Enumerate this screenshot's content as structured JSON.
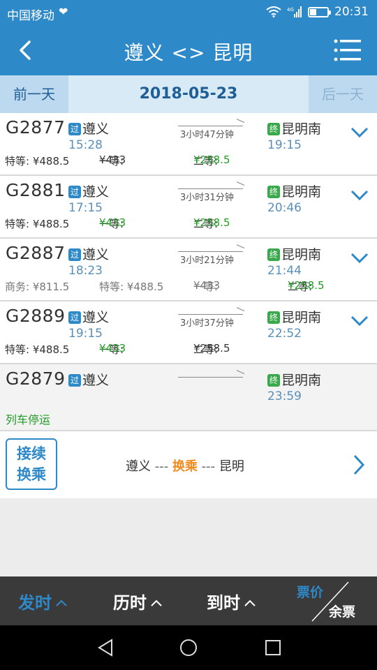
{
  "status": {
    "carrier": "中国移动",
    "network": "4G",
    "time": "20:31"
  },
  "header": {
    "title": "遵义 <> 昆明"
  },
  "datebar": {
    "prev": "前一天",
    "date": "2018-05-23",
    "next": "后一天"
  },
  "badges": {
    "pass": "过",
    "end": "终"
  },
  "trains": [
    {
      "no": "G2877",
      "from": "遵义",
      "dep": "15:28",
      "duration": "3小时47分钟",
      "to": "昆明南",
      "arr": "19:15",
      "p1": "特等: ¥488.5",
      "p2_label": "一等: ",
      "p2_val": "¥433",
      "p3_label": "二等: ",
      "p3_val": "¥258.5"
    },
    {
      "no": "G2881",
      "from": "遵义",
      "dep": "17:15",
      "duration": "3小时31分钟",
      "to": "昆明南",
      "arr": "20:46",
      "p1": "特等: ¥488.5",
      "p2_label": "一等: ",
      "p2_val": "¥433",
      "p3_label": "二等: ",
      "p3_val": "¥258.5"
    },
    {
      "no": "G2887",
      "from": "遵义",
      "dep": "18:23",
      "duration": "3小时21分钟",
      "to": "昆明南",
      "arr": "21:44",
      "p0": "商务: ¥811.5",
      "p1": "特等: ¥488.5",
      "p2_label": "一等: ",
      "p2_val": "¥433",
      "p3_label": "二等: ",
      "p3_val": "¥258.5"
    },
    {
      "no": "G2889",
      "from": "遵义",
      "dep": "19:15",
      "duration": "3小时37分钟",
      "to": "昆明南",
      "arr": "22:52",
      "p1": "特等: ¥488.5",
      "p2_label": "一等: ",
      "p2_val": "¥433",
      "p3_label": "二等: ",
      "p3_val": "¥258.5"
    },
    {
      "no": "G2879",
      "from": "遵义",
      "to": "昆明南",
      "arr": "23:59",
      "stopped": "列车停运"
    }
  ],
  "transfer": {
    "button_line1": "接续",
    "button_line2": "换乘",
    "from": "遵义",
    "sep": " --- ",
    "mid": "换乘",
    "to": "昆明"
  },
  "sortbar": {
    "depart": "发时",
    "duration": "历时",
    "arrive": "到时",
    "price": "票价",
    "remain": "余票"
  },
  "colors": {
    "primary": "#2e89c8",
    "green": "#1f9a22",
    "orange": "#f08a1e",
    "dark": "#3a3a3a"
  }
}
